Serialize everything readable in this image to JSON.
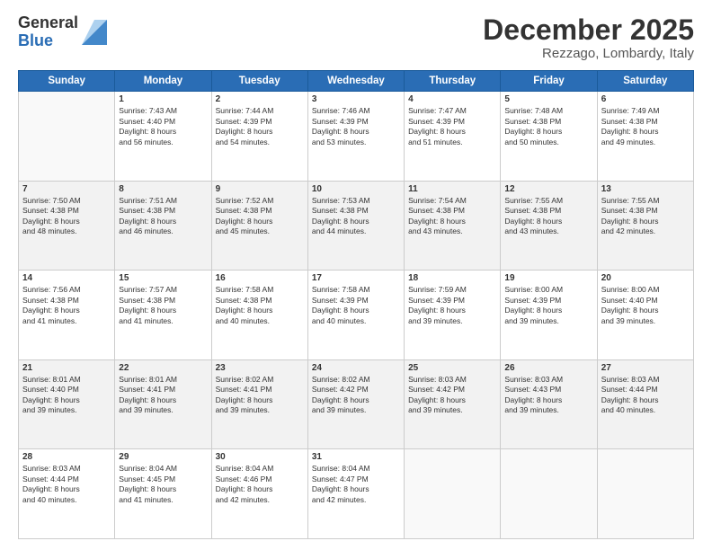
{
  "header": {
    "logo_general": "General",
    "logo_blue": "Blue",
    "month_title": "December 2025",
    "location": "Rezzago, Lombardy, Italy"
  },
  "weekdays": [
    "Sunday",
    "Monday",
    "Tuesday",
    "Wednesday",
    "Thursday",
    "Friday",
    "Saturday"
  ],
  "weeks": [
    [
      {
        "day": "",
        "sunrise": "",
        "sunset": "",
        "daylight": "",
        "empty": true
      },
      {
        "day": "1",
        "sunrise": "Sunrise: 7:43 AM",
        "sunset": "Sunset: 4:40 PM",
        "daylight": "Daylight: 8 hours and 56 minutes."
      },
      {
        "day": "2",
        "sunrise": "Sunrise: 7:44 AM",
        "sunset": "Sunset: 4:39 PM",
        "daylight": "Daylight: 8 hours and 54 minutes."
      },
      {
        "day": "3",
        "sunrise": "Sunrise: 7:46 AM",
        "sunset": "Sunset: 4:39 PM",
        "daylight": "Daylight: 8 hours and 53 minutes."
      },
      {
        "day": "4",
        "sunrise": "Sunrise: 7:47 AM",
        "sunset": "Sunset: 4:39 PM",
        "daylight": "Daylight: 8 hours and 51 minutes."
      },
      {
        "day": "5",
        "sunrise": "Sunrise: 7:48 AM",
        "sunset": "Sunset: 4:38 PM",
        "daylight": "Daylight: 8 hours and 50 minutes."
      },
      {
        "day": "6",
        "sunrise": "Sunrise: 7:49 AM",
        "sunset": "Sunset: 4:38 PM",
        "daylight": "Daylight: 8 hours and 49 minutes."
      }
    ],
    [
      {
        "day": "7",
        "sunrise": "Sunrise: 7:50 AM",
        "sunset": "Sunset: 4:38 PM",
        "daylight": "Daylight: 8 hours and 48 minutes."
      },
      {
        "day": "8",
        "sunrise": "Sunrise: 7:51 AM",
        "sunset": "Sunset: 4:38 PM",
        "daylight": "Daylight: 8 hours and 46 minutes."
      },
      {
        "day": "9",
        "sunrise": "Sunrise: 7:52 AM",
        "sunset": "Sunset: 4:38 PM",
        "daylight": "Daylight: 8 hours and 45 minutes."
      },
      {
        "day": "10",
        "sunrise": "Sunrise: 7:53 AM",
        "sunset": "Sunset: 4:38 PM",
        "daylight": "Daylight: 8 hours and 44 minutes."
      },
      {
        "day": "11",
        "sunrise": "Sunrise: 7:54 AM",
        "sunset": "Sunset: 4:38 PM",
        "daylight": "Daylight: 8 hours and 43 minutes."
      },
      {
        "day": "12",
        "sunrise": "Sunrise: 7:55 AM",
        "sunset": "Sunset: 4:38 PM",
        "daylight": "Daylight: 8 hours and 43 minutes."
      },
      {
        "day": "13",
        "sunrise": "Sunrise: 7:55 AM",
        "sunset": "Sunset: 4:38 PM",
        "daylight": "Daylight: 8 hours and 42 minutes."
      }
    ],
    [
      {
        "day": "14",
        "sunrise": "Sunrise: 7:56 AM",
        "sunset": "Sunset: 4:38 PM",
        "daylight": "Daylight: 8 hours and 41 minutes."
      },
      {
        "day": "15",
        "sunrise": "Sunrise: 7:57 AM",
        "sunset": "Sunset: 4:38 PM",
        "daylight": "Daylight: 8 hours and 41 minutes."
      },
      {
        "day": "16",
        "sunrise": "Sunrise: 7:58 AM",
        "sunset": "Sunset: 4:38 PM",
        "daylight": "Daylight: 8 hours and 40 minutes."
      },
      {
        "day": "17",
        "sunrise": "Sunrise: 7:58 AM",
        "sunset": "Sunset: 4:39 PM",
        "daylight": "Daylight: 8 hours and 40 minutes."
      },
      {
        "day": "18",
        "sunrise": "Sunrise: 7:59 AM",
        "sunset": "Sunset: 4:39 PM",
        "daylight": "Daylight: 8 hours and 39 minutes."
      },
      {
        "day": "19",
        "sunrise": "Sunrise: 8:00 AM",
        "sunset": "Sunset: 4:39 PM",
        "daylight": "Daylight: 8 hours and 39 minutes."
      },
      {
        "day": "20",
        "sunrise": "Sunrise: 8:00 AM",
        "sunset": "Sunset: 4:40 PM",
        "daylight": "Daylight: 8 hours and 39 minutes."
      }
    ],
    [
      {
        "day": "21",
        "sunrise": "Sunrise: 8:01 AM",
        "sunset": "Sunset: 4:40 PM",
        "daylight": "Daylight: 8 hours and 39 minutes."
      },
      {
        "day": "22",
        "sunrise": "Sunrise: 8:01 AM",
        "sunset": "Sunset: 4:41 PM",
        "daylight": "Daylight: 8 hours and 39 minutes."
      },
      {
        "day": "23",
        "sunrise": "Sunrise: 8:02 AM",
        "sunset": "Sunset: 4:41 PM",
        "daylight": "Daylight: 8 hours and 39 minutes."
      },
      {
        "day": "24",
        "sunrise": "Sunrise: 8:02 AM",
        "sunset": "Sunset: 4:42 PM",
        "daylight": "Daylight: 8 hours and 39 minutes."
      },
      {
        "day": "25",
        "sunrise": "Sunrise: 8:03 AM",
        "sunset": "Sunset: 4:42 PM",
        "daylight": "Daylight: 8 hours and 39 minutes."
      },
      {
        "day": "26",
        "sunrise": "Sunrise: 8:03 AM",
        "sunset": "Sunset: 4:43 PM",
        "daylight": "Daylight: 8 hours and 39 minutes."
      },
      {
        "day": "27",
        "sunrise": "Sunrise: 8:03 AM",
        "sunset": "Sunset: 4:44 PM",
        "daylight": "Daylight: 8 hours and 40 minutes."
      }
    ],
    [
      {
        "day": "28",
        "sunrise": "Sunrise: 8:03 AM",
        "sunset": "Sunset: 4:44 PM",
        "daylight": "Daylight: 8 hours and 40 minutes."
      },
      {
        "day": "29",
        "sunrise": "Sunrise: 8:04 AM",
        "sunset": "Sunset: 4:45 PM",
        "daylight": "Daylight: 8 hours and 41 minutes."
      },
      {
        "day": "30",
        "sunrise": "Sunrise: 8:04 AM",
        "sunset": "Sunset: 4:46 PM",
        "daylight": "Daylight: 8 hours and 42 minutes."
      },
      {
        "day": "31",
        "sunrise": "Sunrise: 8:04 AM",
        "sunset": "Sunset: 4:47 PM",
        "daylight": "Daylight: 8 hours and 42 minutes."
      },
      {
        "day": "",
        "sunrise": "",
        "sunset": "",
        "daylight": "",
        "empty": true
      },
      {
        "day": "",
        "sunrise": "",
        "sunset": "",
        "daylight": "",
        "empty": true
      },
      {
        "day": "",
        "sunrise": "",
        "sunset": "",
        "daylight": "",
        "empty": true
      }
    ]
  ]
}
